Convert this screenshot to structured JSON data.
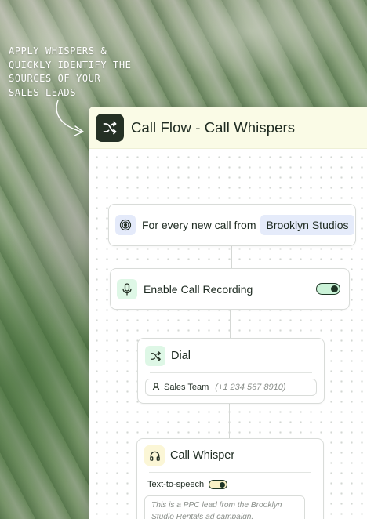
{
  "annotation": {
    "lines": [
      "Apply whispers &",
      "quickly identify the",
      "sources of your",
      "sales leads"
    ]
  },
  "panel": {
    "title": "Call Flow - Call Whispers",
    "header_icon": "shuffle-icon"
  },
  "trigger": {
    "icon": "target-icon",
    "text": "For every new call from",
    "source": "Brooklyn Studios"
  },
  "recording": {
    "icon": "microphone-icon",
    "label": "Enable Call Recording",
    "enabled": true
  },
  "dial": {
    "icon": "shuffle-icon",
    "title": "Dial",
    "team": "Sales Team",
    "phone": "(+1 234 567 8910)"
  },
  "whisper": {
    "icon": "headphones-icon",
    "title": "Call Whisper",
    "tts_label": "Text-to-speech",
    "tts_enabled": true,
    "message": "This is a PPC lead from the Brooklyn Studio Rentals ad campaign."
  },
  "colors": {
    "header_bg": "#fafbe6",
    "dark_green": "#243024",
    "toggle_on": "#cbf3d8",
    "source_tag": "#e5ebfa"
  }
}
